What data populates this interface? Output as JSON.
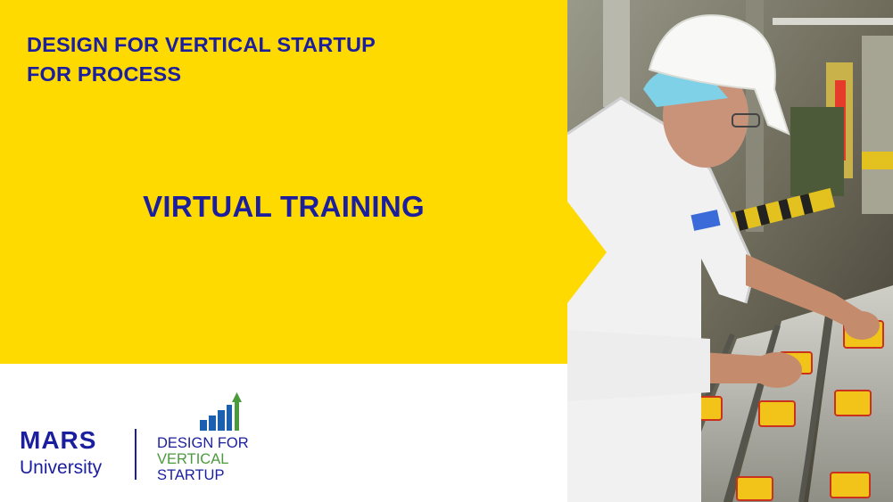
{
  "slide": {
    "headline": [
      "DESIGN FOR VERTICAL STARTUP",
      "FOR PROCESS"
    ],
    "subtitle": "VIRTUAL TRAINING"
  },
  "logos": {
    "mars": {
      "line1": "MARS",
      "line2": "University"
    },
    "dfvs": {
      "line1": "DESIGN FOR",
      "line2": "VERTICAL",
      "line3": "STARTUP"
    }
  },
  "colors": {
    "yellow": "#FEDA00",
    "navy": "#1B1F9E",
    "green": "#4B9A3C"
  },
  "photo": {
    "subject": "worker-inspecting-packaged-products-on-conveyor"
  }
}
